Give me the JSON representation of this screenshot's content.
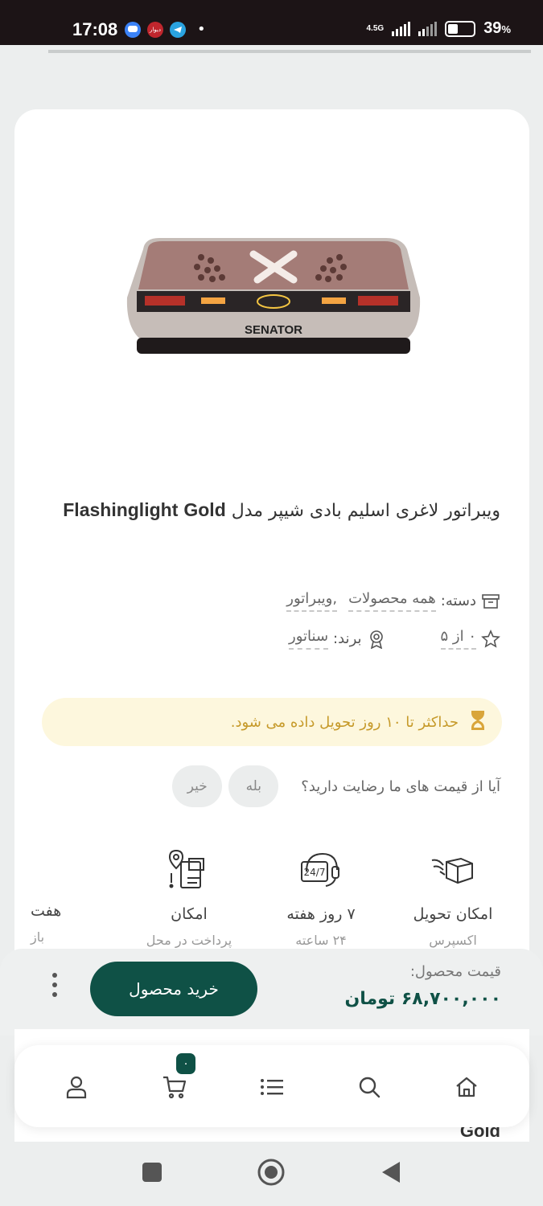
{
  "status_bar": {
    "time": "17:08",
    "network": "4.5G",
    "battery_percent": "39",
    "battery_unit": "%",
    "app_icons": [
      "messages-icon",
      "divar-icon",
      "telegram-icon"
    ],
    "divar_label": "دیوار"
  },
  "product": {
    "image_brand": "SENATOR",
    "title_fa": "ویبراتور لاغری اسلیم بادی شیپر مدل",
    "title_model": "Flashinglight",
    "title_suffix": "Gold",
    "category_label": "دسته:",
    "categories": [
      "همه محصولات",
      "ویبراتور"
    ],
    "category_separator": ",",
    "rating": "۰ از ۵",
    "brand_label": "برند:",
    "brand": "سناتور"
  },
  "delivery": {
    "text": "حداکثر تا ۱۰ روز تحویل داده می شود."
  },
  "feedback": {
    "question": "آیا از قیمت های ما رضایت دارید؟",
    "yes": "بله",
    "no": "خیر"
  },
  "features": [
    {
      "title": "امکان تحویل",
      "subtitle": "اکسپرس",
      "icon": "express-delivery-icon"
    },
    {
      "title": "۷ روز هفته",
      "subtitle": "۲۴ ساعته",
      "icon": "support-24-7-icon"
    },
    {
      "title": "امکان",
      "subtitle": "پرداخت در محل",
      "icon": "pay-on-location-icon"
    },
    {
      "title": "هفت",
      "subtitle": "باز",
      "icon": ""
    }
  ],
  "purchase": {
    "price_label": "قیمت محصول:",
    "price_value": "۶۸,۷۰۰,۰۰۰ تومان",
    "buy_label": "خرید محصول"
  },
  "bottom_nav": {
    "cart_count": "۰",
    "items": [
      "home-icon",
      "search-icon",
      "menu-list-icon",
      "cart-icon",
      "user-icon"
    ],
    "strip_text": "Gold"
  },
  "colors": {
    "primary": "#0f5146",
    "delivery_bg": "#fdf7dd",
    "delivery_text": "#c69a2a"
  }
}
